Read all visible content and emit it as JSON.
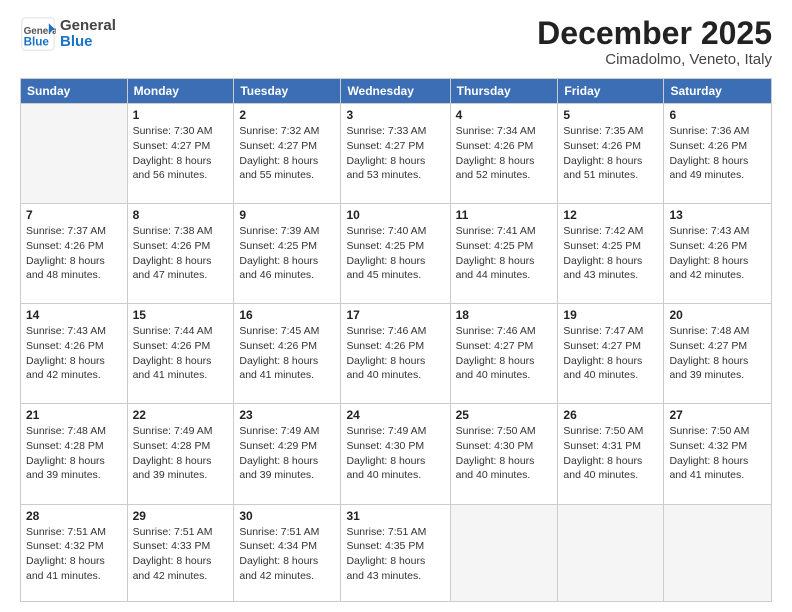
{
  "logo": {
    "general": "General",
    "blue": "Blue"
  },
  "header": {
    "month": "December 2025",
    "location": "Cimadolmo, Veneto, Italy"
  },
  "weekdays": [
    "Sunday",
    "Monday",
    "Tuesday",
    "Wednesday",
    "Thursday",
    "Friday",
    "Saturday"
  ],
  "weeks": [
    [
      {
        "num": "",
        "info": ""
      },
      {
        "num": "1",
        "info": "Sunrise: 7:30 AM\nSunset: 4:27 PM\nDaylight: 8 hours\nand 56 minutes."
      },
      {
        "num": "2",
        "info": "Sunrise: 7:32 AM\nSunset: 4:27 PM\nDaylight: 8 hours\nand 55 minutes."
      },
      {
        "num": "3",
        "info": "Sunrise: 7:33 AM\nSunset: 4:27 PM\nDaylight: 8 hours\nand 53 minutes."
      },
      {
        "num": "4",
        "info": "Sunrise: 7:34 AM\nSunset: 4:26 PM\nDaylight: 8 hours\nand 52 minutes."
      },
      {
        "num": "5",
        "info": "Sunrise: 7:35 AM\nSunset: 4:26 PM\nDaylight: 8 hours\nand 51 minutes."
      },
      {
        "num": "6",
        "info": "Sunrise: 7:36 AM\nSunset: 4:26 PM\nDaylight: 8 hours\nand 49 minutes."
      }
    ],
    [
      {
        "num": "7",
        "info": "Sunrise: 7:37 AM\nSunset: 4:26 PM\nDaylight: 8 hours\nand 48 minutes."
      },
      {
        "num": "8",
        "info": "Sunrise: 7:38 AM\nSunset: 4:26 PM\nDaylight: 8 hours\nand 47 minutes."
      },
      {
        "num": "9",
        "info": "Sunrise: 7:39 AM\nSunset: 4:25 PM\nDaylight: 8 hours\nand 46 minutes."
      },
      {
        "num": "10",
        "info": "Sunrise: 7:40 AM\nSunset: 4:25 PM\nDaylight: 8 hours\nand 45 minutes."
      },
      {
        "num": "11",
        "info": "Sunrise: 7:41 AM\nSunset: 4:25 PM\nDaylight: 8 hours\nand 44 minutes."
      },
      {
        "num": "12",
        "info": "Sunrise: 7:42 AM\nSunset: 4:25 PM\nDaylight: 8 hours\nand 43 minutes."
      },
      {
        "num": "13",
        "info": "Sunrise: 7:43 AM\nSunset: 4:26 PM\nDaylight: 8 hours\nand 42 minutes."
      }
    ],
    [
      {
        "num": "14",
        "info": "Sunrise: 7:43 AM\nSunset: 4:26 PM\nDaylight: 8 hours\nand 42 minutes."
      },
      {
        "num": "15",
        "info": "Sunrise: 7:44 AM\nSunset: 4:26 PM\nDaylight: 8 hours\nand 41 minutes."
      },
      {
        "num": "16",
        "info": "Sunrise: 7:45 AM\nSunset: 4:26 PM\nDaylight: 8 hours\nand 41 minutes."
      },
      {
        "num": "17",
        "info": "Sunrise: 7:46 AM\nSunset: 4:26 PM\nDaylight: 8 hours\nand 40 minutes."
      },
      {
        "num": "18",
        "info": "Sunrise: 7:46 AM\nSunset: 4:27 PM\nDaylight: 8 hours\nand 40 minutes."
      },
      {
        "num": "19",
        "info": "Sunrise: 7:47 AM\nSunset: 4:27 PM\nDaylight: 8 hours\nand 40 minutes."
      },
      {
        "num": "20",
        "info": "Sunrise: 7:48 AM\nSunset: 4:27 PM\nDaylight: 8 hours\nand 39 minutes."
      }
    ],
    [
      {
        "num": "21",
        "info": "Sunrise: 7:48 AM\nSunset: 4:28 PM\nDaylight: 8 hours\nand 39 minutes."
      },
      {
        "num": "22",
        "info": "Sunrise: 7:49 AM\nSunset: 4:28 PM\nDaylight: 8 hours\nand 39 minutes."
      },
      {
        "num": "23",
        "info": "Sunrise: 7:49 AM\nSunset: 4:29 PM\nDaylight: 8 hours\nand 39 minutes."
      },
      {
        "num": "24",
        "info": "Sunrise: 7:49 AM\nSunset: 4:30 PM\nDaylight: 8 hours\nand 40 minutes."
      },
      {
        "num": "25",
        "info": "Sunrise: 7:50 AM\nSunset: 4:30 PM\nDaylight: 8 hours\nand 40 minutes."
      },
      {
        "num": "26",
        "info": "Sunrise: 7:50 AM\nSunset: 4:31 PM\nDaylight: 8 hours\nand 40 minutes."
      },
      {
        "num": "27",
        "info": "Sunrise: 7:50 AM\nSunset: 4:32 PM\nDaylight: 8 hours\nand 41 minutes."
      }
    ],
    [
      {
        "num": "28",
        "info": "Sunrise: 7:51 AM\nSunset: 4:32 PM\nDaylight: 8 hours\nand 41 minutes."
      },
      {
        "num": "29",
        "info": "Sunrise: 7:51 AM\nSunset: 4:33 PM\nDaylight: 8 hours\nand 42 minutes."
      },
      {
        "num": "30",
        "info": "Sunrise: 7:51 AM\nSunset: 4:34 PM\nDaylight: 8 hours\nand 42 minutes."
      },
      {
        "num": "31",
        "info": "Sunrise: 7:51 AM\nSunset: 4:35 PM\nDaylight: 8 hours\nand 43 minutes."
      },
      {
        "num": "",
        "info": ""
      },
      {
        "num": "",
        "info": ""
      },
      {
        "num": "",
        "info": ""
      }
    ]
  ]
}
